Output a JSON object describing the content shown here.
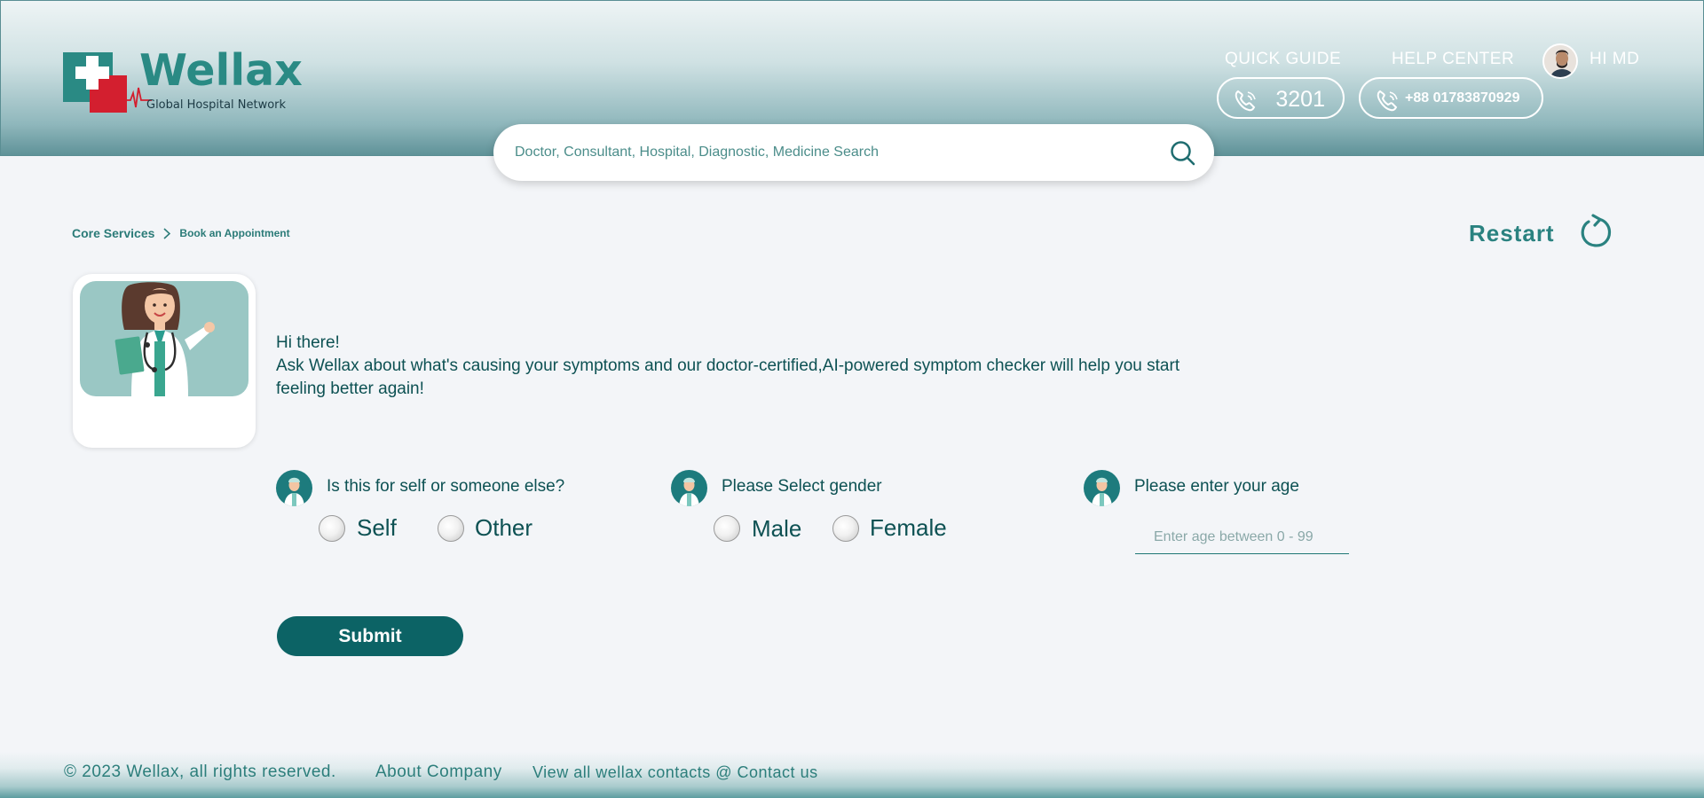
{
  "brand": {
    "name": "Wellax",
    "tagline": "Global Hospital Network"
  },
  "header": {
    "quick_guide_label": "QUICK GUIDE",
    "quick_guide_number": "3201",
    "help_center_label": "HELP CENTER",
    "help_center_number": "+88 01783870929",
    "user_greeting": "HI MD"
  },
  "search": {
    "placeholder": "Doctor, Consultant, Hospital, Diagnostic, Medicine Search"
  },
  "breadcrumb": {
    "level1": "Core Services",
    "level2": "Book an Appointment"
  },
  "restart_label": "Restart",
  "intro": {
    "greeting": "Hi there!",
    "message": "Ask Wellax about what's causing your symptoms and our doctor-certified,AI-powered symptom checker will help you start feeling better again!"
  },
  "questions": {
    "who": {
      "text": "Is this for self or someone else?",
      "options": [
        "Self",
        "Other"
      ]
    },
    "gender": {
      "text": "Please Select gender",
      "options": [
        "Male",
        "Female"
      ]
    },
    "age": {
      "text": "Please enter your age",
      "placeholder": "Enter age between 0 - 99"
    }
  },
  "submit_label": "Submit",
  "footer": {
    "copyright": "© 2023 Wellax, all rights reserved.",
    "about": "About Company",
    "contacts": "View all wellax contacts @ Contact us"
  },
  "colors": {
    "primary": "#0c6365",
    "accent_text": "#2a8a84",
    "brand_red": "#d31f2f"
  }
}
